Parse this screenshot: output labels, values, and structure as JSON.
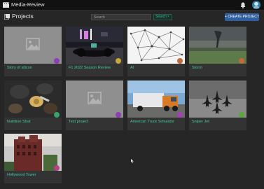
{
  "app": {
    "title": "Media-Review"
  },
  "header": {
    "title": "Projects"
  },
  "search": {
    "placeholder": "Search",
    "button_label": "Search",
    "clear_label": "×"
  },
  "create_button": {
    "label": "+ CREATE PROJECT"
  },
  "projects": [
    {
      "name": "Story of silicon",
      "thumbnail": "placeholder",
      "badge_color": "#8e3fb8"
    },
    {
      "name": "F1 2022 Season Review",
      "thumbnail": "f1-car-photo",
      "badge_color": "#c8a63a"
    },
    {
      "name": "AI",
      "thumbnail": "network-graph-photo",
      "badge_color": "#c26a3a"
    },
    {
      "name": "Storm",
      "thumbnail": "tornado-photo",
      "badge_color": "#c26a3a"
    },
    {
      "name": "Nutrition Strat",
      "thumbnail": "nuts-photo",
      "badge_color": "#3aa36b"
    },
    {
      "name": "Test project",
      "thumbnail": "placeholder",
      "badge_color": "#8e3fb8"
    },
    {
      "name": "American Truck Simulator",
      "thumbnail": "truck-photo",
      "badge_color": "#a63fb8"
    },
    {
      "name": "Sniper Jet",
      "thumbnail": "jets-photo",
      "badge_color": "#5aa83a"
    },
    {
      "name": "Hollywood Tower",
      "thumbnail": "tower-photo",
      "badge_color": "#b83f8a"
    }
  ],
  "colors": {
    "accent": "#3fcca0",
    "primary_button": "#2f5f9c",
    "background": "#262626",
    "topbar": "#111111"
  }
}
